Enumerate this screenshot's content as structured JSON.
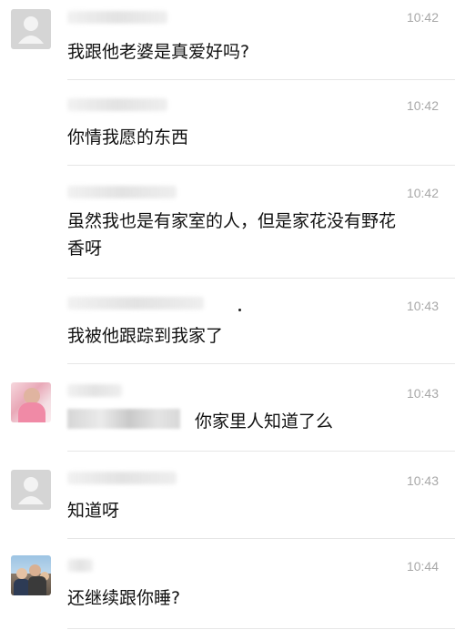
{
  "messages": [
    {
      "time": "10:42",
      "text": "我跟他老婆是真爱好吗?"
    },
    {
      "time": "10:42",
      "text": "你情我愿的东西"
    },
    {
      "time": "10:42",
      "text": "虽然我也是有家室的人，但是家花没有野花\n香呀"
    },
    {
      "time": "10:43",
      "text": "我被他跟踪到我家了"
    },
    {
      "time": "10:43",
      "text": "你家里人知道了么"
    },
    {
      "time": "10:43",
      "text": "知道呀"
    },
    {
      "time": "10:44",
      "text": "还继续跟你睡?"
    }
  ],
  "avatars": [
    "default-avatar-icon",
    "default-avatar-icon",
    "pink-photo-avatar",
    "default-avatar-icon",
    "group-photo-avatar"
  ]
}
